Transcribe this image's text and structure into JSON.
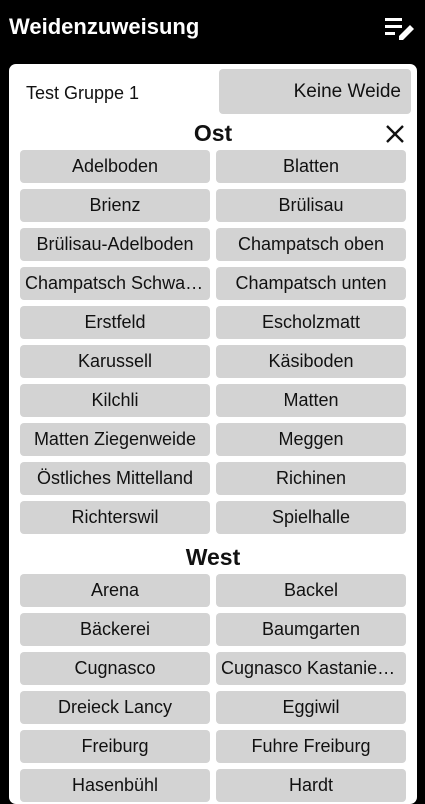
{
  "app": {
    "title": "Weidenzuweisung",
    "menu_icon": "playlist-edit-icon"
  },
  "group": {
    "name": "Test Gruppe 1",
    "current_button": "Keine Weide"
  },
  "close_icon": "close-icon",
  "sections": {
    "ost": {
      "title": "Ost",
      "items": [
        "Adelboden",
        "Blatten",
        "Brienz",
        "Brülisau",
        "Brülisau-Adelboden",
        "Champatsch oben",
        "Champatsch Schwarzsee",
        "Champatsch unten",
        "Erstfeld",
        "Escholzmatt",
        "Karussell",
        "Käsiboden",
        "Kilchli",
        "Matten",
        "Matten Ziegenweide",
        "Meggen",
        "Östliches Mittelland",
        "Richinen",
        "Richterswil",
        "Spielhalle"
      ]
    },
    "west": {
      "title": "West",
      "items": [
        "Arena",
        "Backel",
        "Bäckerei",
        "Baumgarten",
        "Cugnasco",
        "Cugnasco Kastanienhain",
        "Dreieck Lancy",
        "Eggiwil",
        "Freiburg",
        "Fuhre Freiburg",
        "Hasenbühl",
        "Hardt"
      ]
    }
  }
}
